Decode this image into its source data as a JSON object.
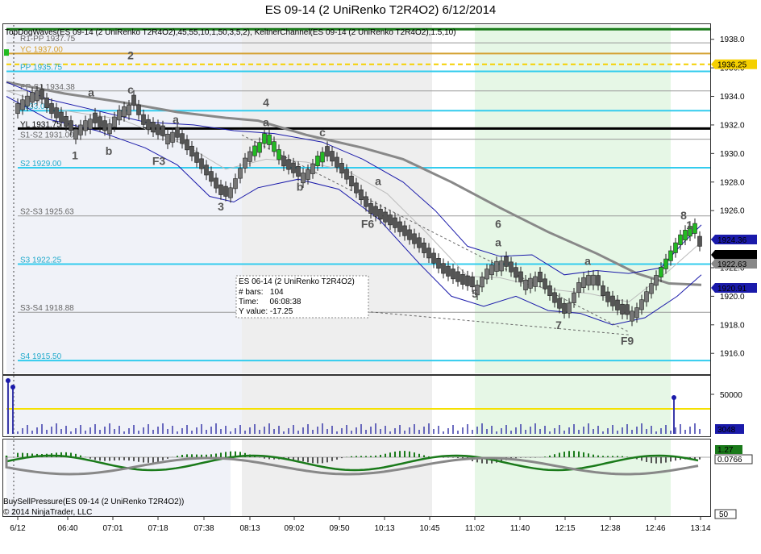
{
  "title": "ES 09-14 (2 UniRenko T2R4O2)  6/12/2014",
  "indicator_label": "TopDogWaves(ES 09-14 (2 UniRenko T2R4O2),45,55,10,1,50,3,5,2), KeltnerChannel(ES 09-14 (2 UniRenko T2R4O2),1.5,10)",
  "bsp_label": "BuySellPressure(ES 09-14 (2 UniRenko T2R4O2))",
  "copyright": "© 2014 NinjaTrader, LLC",
  "colors": {
    "up_bar": "#22bb22",
    "down_bar": "#555555",
    "keltner": "#1a1aaa",
    "ma": "#888888",
    "green_zone": "#e6f7e6",
    "gray_zone": "#eeeeee",
    "blue_zone": "#f0f2f8"
  },
  "chart_data": {
    "type": "candlestick",
    "title": "ES 09-14 (2 UniRenko T2R4O2)  6/12/2014",
    "price_axis": {
      "ticks": [
        1916.0,
        1918.0,
        1920.0,
        1922.0,
        1924.0,
        1926.0,
        1928.0,
        1930.0,
        1932.0,
        1934.0,
        1936.0,
        1938.0
      ],
      "range": [
        1914.6,
        1939.0
      ]
    },
    "time_axis": {
      "labels": [
        "6/12",
        "06:40",
        "07:01",
        "07:18",
        "07:38",
        "08:13",
        "09:02",
        "09:50",
        "10:13",
        "10:45",
        "11:02",
        "11:40",
        "12:15",
        "12:38",
        "12:46",
        "13:14"
      ]
    },
    "levels": [
      {
        "label": "R1-PP 1937.75",
        "value": 1937.75,
        "color": "#999999"
      },
      {
        "label": "YC 1937.00",
        "value": 1937.0,
        "color": "#d4a030"
      },
      {
        "label": "PP 1935.75",
        "value": 1935.75,
        "color": "#33ccee"
      },
      {
        "label": "PP-S1 1934.38",
        "value": 1934.38,
        "color": "#999999"
      },
      {
        "label": "1933.00",
        "value": 1933.0,
        "color": "#33ccee"
      },
      {
        "label": "YL 1931.75",
        "value": 1931.75,
        "color": "#000000"
      },
      {
        "label": "S1-S2 1931.00",
        "value": 1931.0,
        "color": "#999999"
      },
      {
        "label": "S2 1929.00",
        "value": 1929.0,
        "color": "#33ccee"
      },
      {
        "label": "S2-S3 1925.63",
        "value": 1925.63,
        "color": "#999999"
      },
      {
        "label": "S3 1922.25",
        "value": 1922.25,
        "color": "#33ccee"
      },
      {
        "label": "S3-S4 1918.88",
        "value": 1918.88,
        "color": "#999999"
      },
      {
        "label": "S4 1915.50",
        "value": 1915.5,
        "color": "#33ccee"
      }
    ],
    "price_markers": [
      {
        "label": "1936.25",
        "value": 1936.25,
        "color": "#f5d000"
      },
      {
        "label": "1924.36",
        "value": 1924.36,
        "color": "#1a1aaa"
      },
      {
        "label": "1923.25",
        "value": 1923.25,
        "color": "#000000"
      },
      {
        "label": "1922.63",
        "value": 1922.63,
        "color": "#888888"
      },
      {
        "label": "1920.91",
        "value": 1920.91,
        "color": "#1a1aaa"
      }
    ],
    "wave_labels": [
      {
        "text": "2",
        "x": "07:01",
        "value": 1936.6
      },
      {
        "text": "c",
        "x": "07:01",
        "value": 1934.2
      },
      {
        "text": "a",
        "x": "06:40",
        "value": 1934.0
      },
      {
        "text": "1",
        "x": "06:40",
        "value": 1929.6
      },
      {
        "text": "b",
        "x": "07:01",
        "value": 1929.9
      },
      {
        "text": "a",
        "x": "07:18",
        "value": 1932.1
      },
      {
        "text": "F3",
        "x": "07:18",
        "value": 1929.2
      },
      {
        "text": "3",
        "x": "07:38",
        "value": 1926.0
      },
      {
        "text": "4",
        "x": "08:13",
        "value": 1933.3
      },
      {
        "text": "a",
        "x": "08:13",
        "value": 1931.9
      },
      {
        "text": "c",
        "x": "09:50",
        "value": 1931.2
      },
      {
        "text": "b",
        "x": "09:02",
        "value": 1927.4
      },
      {
        "text": "a",
        "x": "10:13",
        "value": 1927.8
      },
      {
        "text": "F6",
        "x": "10:13",
        "value": 1924.8
      },
      {
        "text": "6",
        "x": "11:40",
        "value": 1924.8
      },
      {
        "text": "a",
        "x": "11:40",
        "value": 1923.5
      },
      {
        "text": "5",
        "x": "11:02",
        "value": 1919.9
      },
      {
        "text": "a",
        "x": "12:38",
        "value": 1922.2
      },
      {
        "text": "7",
        "x": "12:15",
        "value": 1917.7
      },
      {
        "text": "F9",
        "x": "12:38",
        "value": 1916.6
      },
      {
        "text": "8",
        "x": "12:46",
        "value": 1925.4
      },
      {
        "text": "1",
        "x": "12:46",
        "value": 1924.7
      }
    ],
    "info_box": {
      "title": "ES 06-14 (2 UniRenko T2R4O2)",
      "lines": [
        "# bars:   104",
        "Time:     06:08:38",
        "Y value: -17.25"
      ]
    },
    "volume_panel": {
      "ticks": [
        50000
      ],
      "marker_label": "3048"
    },
    "bsp_panel": {
      "markers": [
        "1.27",
        "0.0766"
      ],
      "axis_label": "50"
    }
  }
}
